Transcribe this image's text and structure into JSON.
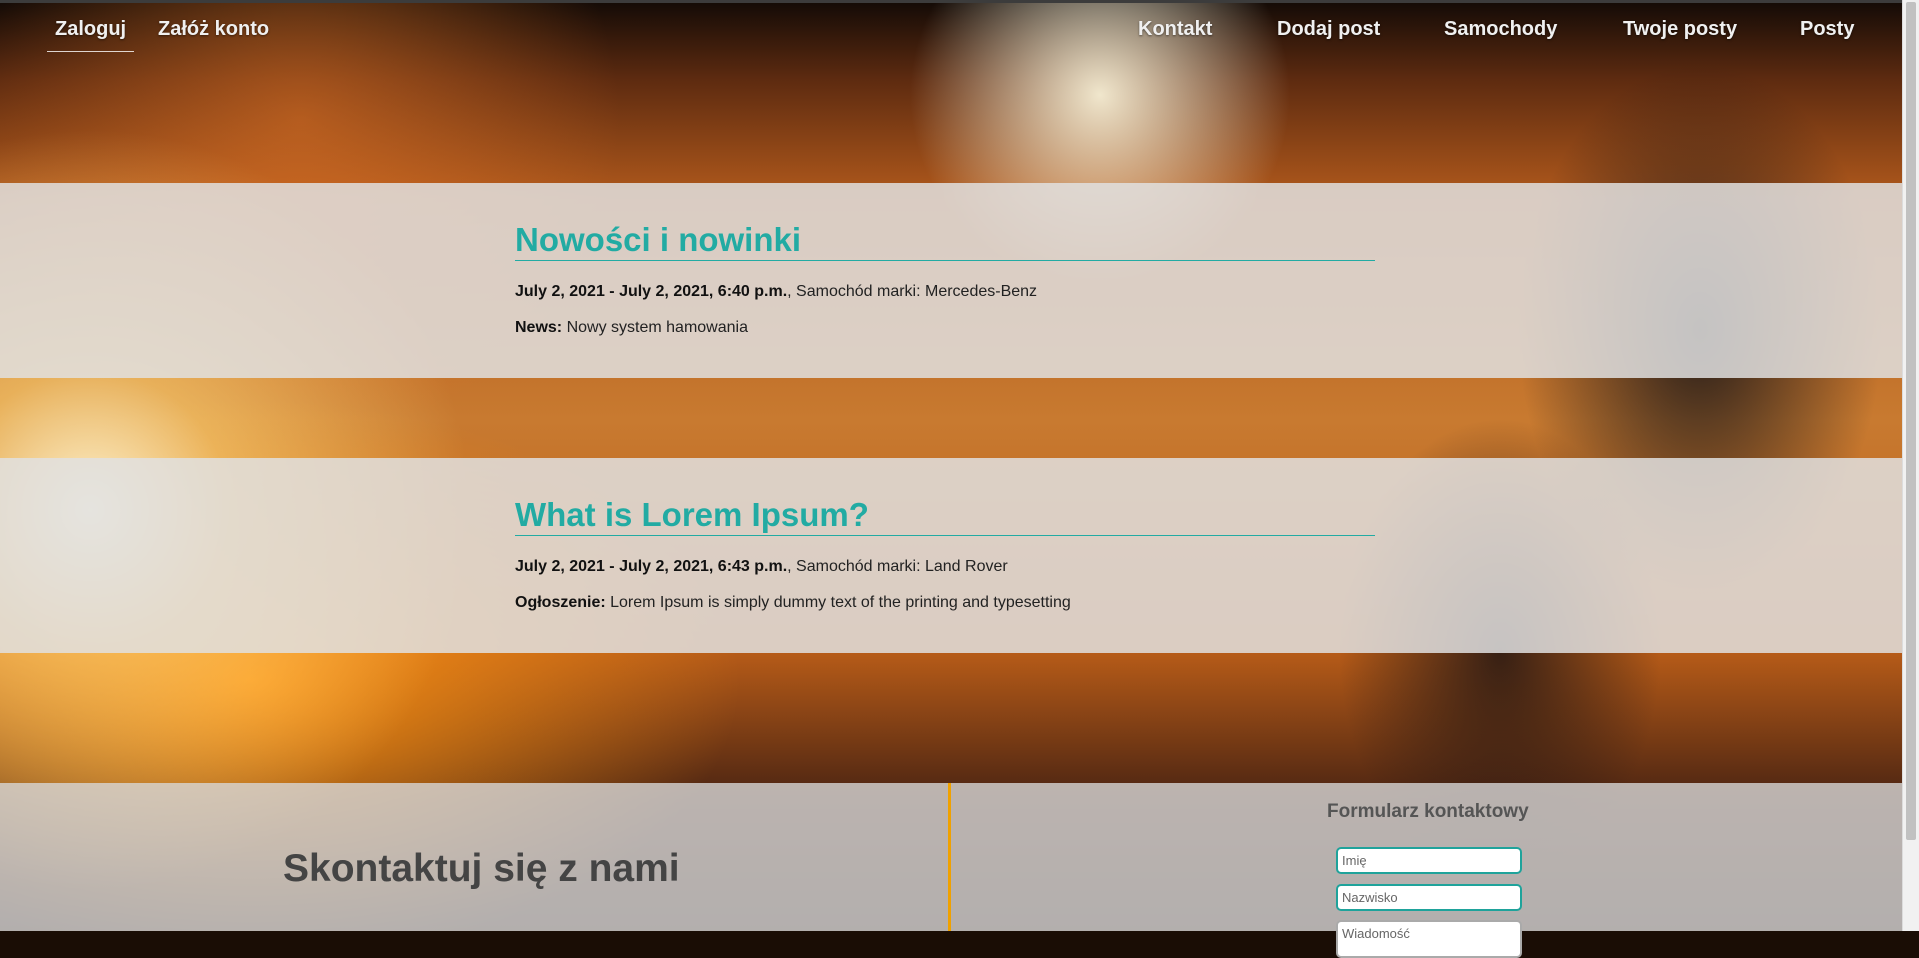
{
  "nav": {
    "left": [
      {
        "label": "Zaloguj",
        "active": true
      },
      {
        "label": "Załóż konto",
        "active": false
      }
    ],
    "right": [
      {
        "label": "Kontakt"
      },
      {
        "label": "Dodaj post"
      },
      {
        "label": "Samochody"
      },
      {
        "label": "Twoje posty"
      },
      {
        "label": "Posty"
      }
    ]
  },
  "posts": [
    {
      "title": "Nowości i nowinki",
      "date": "July 2, 2021 - July 2, 2021, 6:40 p.m.",
      "brand_text": ", Samochód marki: Mercedes-Benz",
      "kind_label": "News:",
      "content": " Nowy system hamowania"
    },
    {
      "title": "What is Lorem Ipsum?",
      "date": "July 2, 2021 - July 2, 2021, 6:43 p.m.",
      "brand_text": ", Samochód marki: Land Rover",
      "kind_label": "Ogłoszenie:",
      "content": " Lorem Ipsum is simply dummy text of the printing and typesetting"
    }
  ],
  "contact": {
    "heading": "Skontaktuj się z nami",
    "form_title": "Formularz kontaktowy",
    "first_name_placeholder": "Imię",
    "last_name_placeholder": "Nazwisko",
    "message_placeholder": "Wiadomość"
  },
  "colors": {
    "accent": "#22aba3",
    "divider": "#f0a100",
    "heading": "#444444"
  }
}
